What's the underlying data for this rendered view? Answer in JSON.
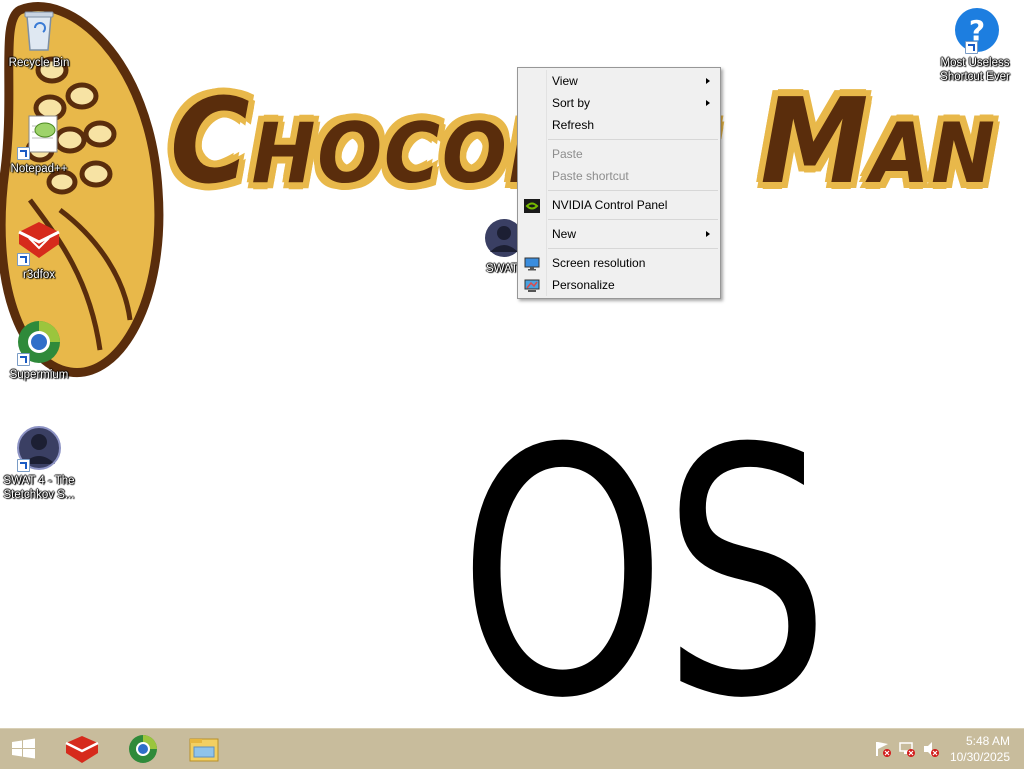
{
  "wallpaper": {
    "title_text": "Chocolate Man",
    "os_text": "OS"
  },
  "desktop_icons": [
    {
      "label": "Recycle Bin",
      "icon": "recycle-bin-icon"
    },
    {
      "label": "Notepad++",
      "icon": "notepad-plus-plus-icon"
    },
    {
      "label": "r3dfox",
      "icon": "r3dfox-icon"
    },
    {
      "label": "Supermium",
      "icon": "supermium-icon"
    },
    {
      "label": "SWAT 4 - The Stetchkov S...",
      "icon": "swat4-icon"
    },
    {
      "label": "Most Useless Shortcut Ever",
      "icon": "help-question-icon"
    }
  ],
  "hidden_icon_label": "SWAT",
  "context_menu": {
    "view": "View",
    "sort_by": "Sort by",
    "refresh": "Refresh",
    "paste": "Paste",
    "paste_shortcut": "Paste shortcut",
    "nvidia": "NVIDIA Control Panel",
    "new": "New",
    "screen_resolution": "Screen resolution",
    "personalize": "Personalize"
  },
  "taskbar": {
    "pinned": [
      "start-button",
      "r3dfox",
      "supermium",
      "file-explorer"
    ],
    "clock_time": "5:48 AM",
    "clock_date": "10/30/2025"
  },
  "colors": {
    "taskbar": "#c8bc9c",
    "wall_brown": "#5a2d0c",
    "wall_gold": "#e8b84a",
    "menu_bg": "#f0f0f0"
  }
}
